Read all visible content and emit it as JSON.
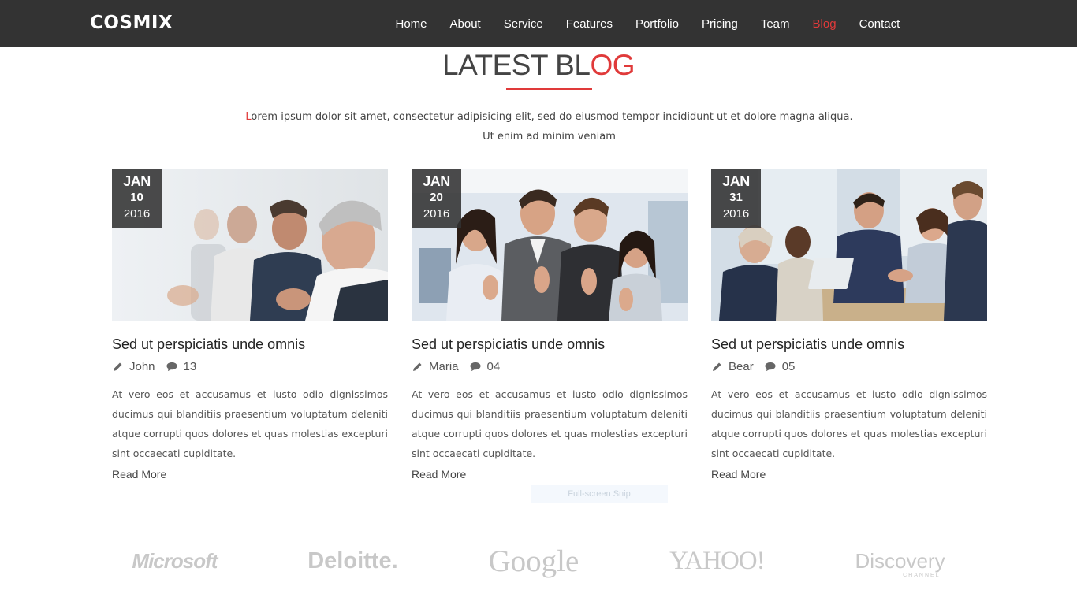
{
  "nav": {
    "brand": "COSMIX",
    "items": [
      {
        "label": "Home"
      },
      {
        "label": "About"
      },
      {
        "label": "Service"
      },
      {
        "label": "Features"
      },
      {
        "label": "Portfolio"
      },
      {
        "label": "Pricing"
      },
      {
        "label": "Team"
      },
      {
        "label": "Blog",
        "active": true
      },
      {
        "label": "Contact"
      }
    ]
  },
  "section": {
    "title_main": "LATEST BL",
    "title_accent": "OG",
    "intro_first_letter": "L",
    "intro_line1_rest": "orem ipsum dolor sit amet, consectetur adipisicing elit, sed do eiusmod tempor incididunt ut et dolore magna aliqua.",
    "intro_line2": "Ut enim ad minim veniam"
  },
  "posts": [
    {
      "month": "JAN",
      "day": "10",
      "year": "2016",
      "title": "Sed ut perspiciatis unde omnis",
      "author": "John",
      "comments": "13",
      "excerpt": "At vero eos et accusamus et iusto odio dignissimos ducimus qui blanditiis praesentium voluptatum deleniti atque corrupti quos dolores et quas molestias excepturi sint occaecati cupiditate.",
      "read_more": "Read More"
    },
    {
      "month": "JAN",
      "day": "20",
      "year": "2016",
      "title": "Sed ut perspiciatis unde omnis",
      "author": "Maria",
      "comments": "04",
      "excerpt": "At vero eos et accusamus et iusto odio dignissimos ducimus qui blanditiis praesentium voluptatum deleniti atque corrupti quos dolores et quas molestias excepturi sint occaecati cupiditate.",
      "read_more": "Read More"
    },
    {
      "month": "JAN",
      "day": "31",
      "year": "2016",
      "title": "Sed ut perspiciatis unde omnis",
      "author": "Bear",
      "comments": "05",
      "excerpt": "At vero eos et accusamus et iusto odio dignissimos ducimus qui blanditiis praesentium voluptatum deleniti atque corrupti quos dolores et quas molestias excepturi sint occaecati cupiditate.",
      "read_more": "Read More"
    }
  ],
  "overlay": {
    "snip_label": "Full-screen Snip"
  },
  "clients": {
    "microsoft": "Microsoft",
    "deloitte": "Deloitte.",
    "google": "Google",
    "yahoo": "YAHOO!",
    "discovery": "Discovery",
    "discovery_sub": "CHANNEL"
  },
  "colors": {
    "navbar_bg": "#333333",
    "accent": "#e03a3a",
    "badge_bg": "#323232",
    "logo_gray": "#c8c8c8"
  },
  "icons": {
    "author": "pencil-icon",
    "comments": "comment-icon"
  }
}
